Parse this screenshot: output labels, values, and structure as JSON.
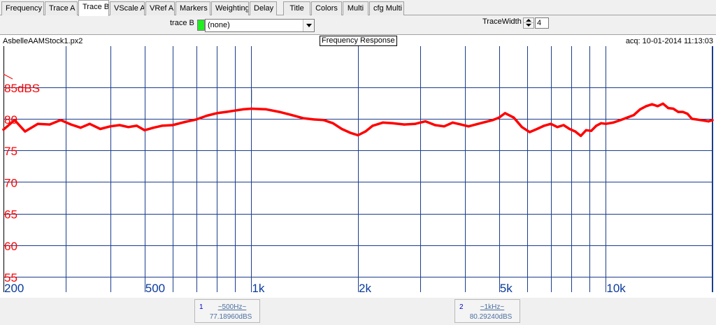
{
  "tabs": [
    {
      "label": "Frequency",
      "active": false
    },
    {
      "label": "Trace A",
      "active": false
    },
    {
      "label": "Trace B",
      "active": true
    },
    {
      "label": "VScale A",
      "active": false
    },
    {
      "label": "VRef A",
      "active": false
    },
    {
      "label": "Markers",
      "active": false
    },
    {
      "label": "Weighting",
      "active": false
    },
    {
      "label": "Delay",
      "active": false
    },
    {
      "label": "Title",
      "active": false
    },
    {
      "label": "Colors",
      "active": false
    },
    {
      "label": "Multi",
      "active": false
    },
    {
      "label": "cfg Multi",
      "active": false
    }
  ],
  "controls": {
    "trace_b_label": "trace B",
    "trace_b_color": "#22ee22",
    "trace_b_value": "(none)",
    "trace_width_label": "TraceWidth",
    "trace_width_value": "4"
  },
  "header": {
    "filename": "AsbelleAAMStock1.px2",
    "title": "Frequency Response",
    "acq": "acq: 10-01-2014 11:13:03"
  },
  "markers": [
    {
      "num": "1",
      "freq": "~500Hz~",
      "value": "77.18960dBS"
    },
    {
      "num": "2",
      "freq": "~1kHz~",
      "value": "80.29240dBS"
    }
  ],
  "chart_data": {
    "type": "line",
    "title": "Frequency Response",
    "xscale": "log",
    "xlim": [
      200,
      20000
    ],
    "ylim": [
      55,
      87
    ],
    "yunit": "dBS",
    "x_tick_labels": [
      {
        "value": 200,
        "label": "200"
      },
      {
        "value": 500,
        "label": "500"
      },
      {
        "value": 1000,
        "label": "1k"
      },
      {
        "value": 2000,
        "label": "2k"
      },
      {
        "value": 5000,
        "label": "5k"
      },
      {
        "value": 10000,
        "label": "10k"
      }
    ],
    "x_gridlines": [
      200,
      300,
      400,
      500,
      600,
      700,
      800,
      900,
      1000,
      2000,
      3000,
      4000,
      5000,
      6000,
      7000,
      8000,
      9000,
      10000,
      20000
    ],
    "y_tick_labels": [
      {
        "value": 85,
        "label": "85dBS"
      },
      {
        "value": 80,
        "label": "80"
      },
      {
        "value": 75,
        "label": "75"
      },
      {
        "value": 70,
        "label": "70"
      },
      {
        "value": 65,
        "label": "65"
      },
      {
        "value": 60,
        "label": "60"
      },
      {
        "value": 55,
        "label": "55"
      }
    ],
    "y_gridlines": [
      85,
      80,
      75,
      70,
      65,
      60,
      55
    ],
    "grid": true,
    "grid_color": "#1a3d8c",
    "trace_color": "#ff0000",
    "label_color": "#ff0000",
    "x_label_color": "#0a3a9c",
    "series": [
      {
        "x": [
          200,
          215,
          230,
          250,
          270,
          290,
          310,
          330,
          350,
          375,
          400,
          425,
          450,
          475,
          500,
          530,
          560,
          600,
          650,
          700,
          750,
          800,
          850,
          900,
          950,
          1000,
          1100,
          1200,
          1300,
          1400,
          1500,
          1600,
          1700,
          1800,
          1900,
          2000,
          2100,
          2200,
          2350,
          2500,
          2700,
          2900,
          3100,
          3300,
          3500,
          3700,
          3900,
          4100,
          4300,
          4500,
          4800,
          5000,
          5200,
          5500,
          5800,
          6100,
          6400,
          6700,
          7000,
          7300,
          7600,
          7900,
          8200,
          8500,
          8800,
          9100,
          9400,
          9700,
          10000,
          10500,
          11000,
          11500,
          12000,
          12500,
          13000,
          13500,
          14000,
          14500,
          15000,
          15500,
          16000,
          16500,
          17000,
          17500,
          18000,
          18500,
          19000,
          19500,
          20000
        ],
        "y": [
          78.3,
          79.8,
          78.0,
          79.2,
          79.1,
          79.8,
          79.1,
          78.6,
          79.2,
          78.4,
          78.8,
          79.0,
          78.7,
          78.9,
          78.2,
          78.6,
          78.9,
          79.0,
          79.5,
          79.9,
          80.5,
          80.9,
          81.1,
          81.3,
          81.5,
          81.6,
          81.5,
          81.1,
          80.6,
          80.1,
          79.9,
          79.8,
          79.3,
          78.4,
          77.8,
          77.4,
          78.0,
          78.9,
          79.4,
          79.3,
          79.1,
          79.2,
          79.6,
          79.0,
          78.8,
          79.4,
          79.1,
          78.8,
          79.1,
          79.4,
          79.8,
          80.2,
          80.9,
          80.2,
          78.7,
          77.9,
          78.4,
          78.9,
          79.2,
          78.7,
          79.0,
          78.4,
          78.0,
          77.3,
          78.2,
          78.1,
          78.9,
          79.3,
          79.2,
          79.4,
          79.8,
          80.2,
          80.6,
          81.5,
          82.0,
          82.3,
          82.0,
          82.4,
          81.7,
          81.6,
          81.1,
          81.1,
          80.8,
          80.0,
          79.9,
          79.8,
          79.7,
          79.6,
          79.8
        ]
      }
    ]
  }
}
